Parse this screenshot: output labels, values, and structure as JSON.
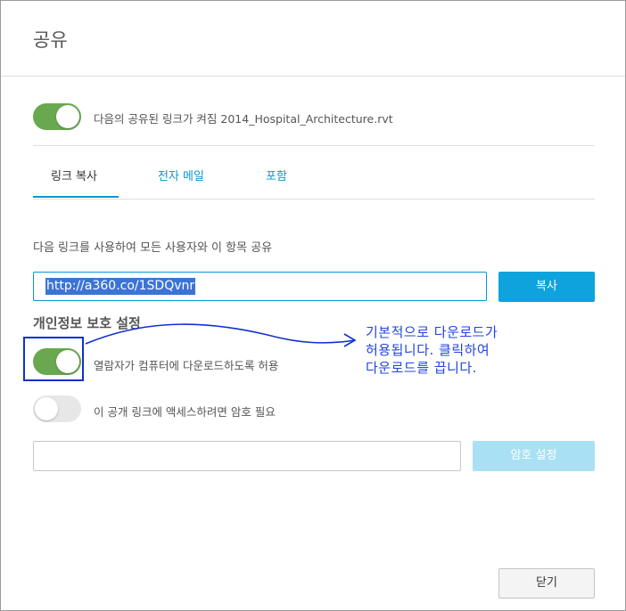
{
  "dialog": {
    "title": "공유",
    "share_toggle": {
      "state": "on",
      "label": "다음의 공유된 링크가 켜짐 2014_Hospital_Architecture.rvt"
    },
    "tabs": [
      {
        "label": "링크 복사",
        "active": true
      },
      {
        "label": "전자 메일",
        "active": false
      },
      {
        "label": "포함",
        "active": false
      }
    ],
    "link_section": {
      "instruction": "다음 링크를 사용하여 모든 사용자와 이 항목 공유",
      "url": "http://a360.co/1SDQvnr",
      "copy_button": "복사"
    },
    "privacy": {
      "title": "개인정보 보호 설정",
      "download_toggle": {
        "state": "on",
        "label": "열람자가 컴퓨터에 다운로드하도록 허용"
      },
      "password_toggle": {
        "state": "off",
        "label": "이 공개 링크에 액세스하려면 암호 필요"
      },
      "password_value": "",
      "set_password_button": "암호 설정"
    },
    "close_button": "닫기"
  },
  "annotation": {
    "lines": [
      "기본적으로 다운로드가",
      "허용됩니다. 클릭하여",
      "다운로드를 끕니다."
    ],
    "color": "#2244e0"
  },
  "colors": {
    "accent": "#0696d7",
    "toggle_on": "#6aa84f",
    "button_primary": "#0ea3dc",
    "button_disabled": "#a9e0f4",
    "annotation": "#1030d0"
  }
}
